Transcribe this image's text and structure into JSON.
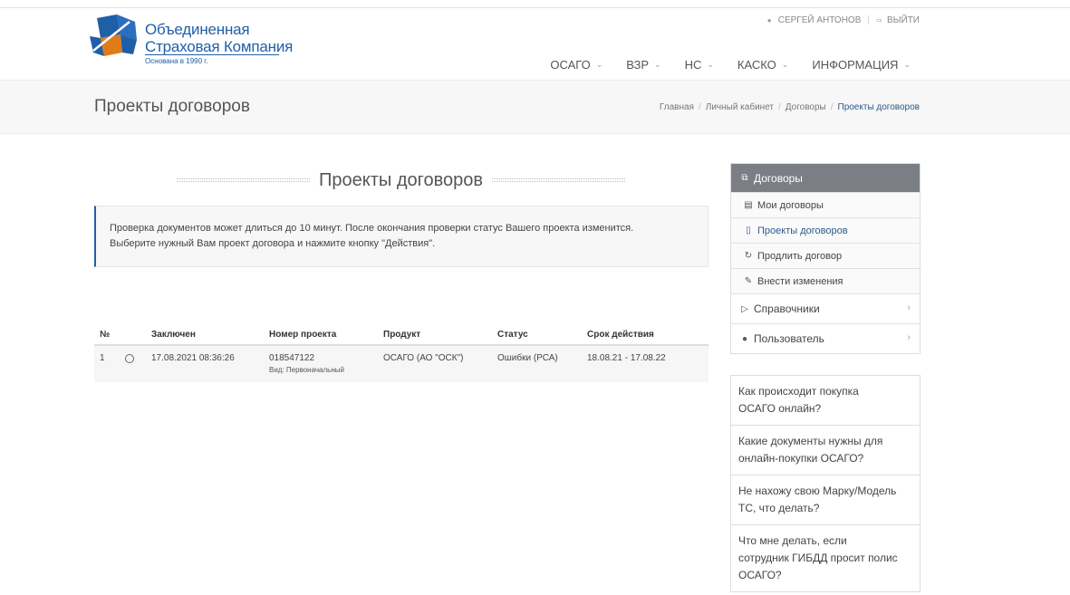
{
  "brand": {
    "line1": "Объединенная",
    "line2": "Страховая Компания",
    "tagline": "Основана в 1990 г.",
    "colors": {
      "blue": "#1f5fa8",
      "orange": "#e07b1a"
    }
  },
  "user_bar": {
    "user_icon": "user-icon",
    "user_name": "СЕРГЕЙ АНТОНОВ",
    "separator": "|",
    "logout_icon": "logout-icon",
    "logout_label": "ВЫЙТИ"
  },
  "nav": {
    "items": [
      {
        "label": "ОСАГО"
      },
      {
        "label": "ВЗР"
      },
      {
        "label": "НС"
      },
      {
        "label": "КАСКО"
      },
      {
        "label": "ИНФОРМАЦИЯ"
      }
    ]
  },
  "page": {
    "title": "Проекты договоров",
    "breadcrumb": [
      "Главная",
      "Личный кабинет",
      "Договоры",
      "Проекты договоров"
    ]
  },
  "content": {
    "heading": "Проекты договоров",
    "notice_line1": "Проверка документов может длиться до 10 минут. После окончания проверки статус Вашего проекта изменится.",
    "notice_line2": "Выберите нужный Вам проект договора и нажмите кнопку \"Действия\"."
  },
  "table": {
    "headers": {
      "no": "№",
      "concluded": "Заключен",
      "project_number": "Номер проекта",
      "product": "Продукт",
      "status": "Статус",
      "term": "Срок действия"
    },
    "rows": [
      {
        "no": "1",
        "concluded": "17.08.2021 08:36:26",
        "project_number": "018547122",
        "kind": "Вид: Первоначальный",
        "product": "ОСАГО (АО \"ОСК\")",
        "status": "Ошибки (РСА)",
        "term": "18.08.21 - 17.08.22"
      }
    ]
  },
  "sidebar": {
    "header": "Договоры",
    "sub_items": [
      {
        "label": "Мои договоры",
        "icon": "document-icon"
      },
      {
        "label": "Проекты договоров",
        "icon": "word-file-icon"
      },
      {
        "label": "Продлить договор",
        "icon": "refresh-icon"
      },
      {
        "label": "Внести изменения",
        "icon": "edit-icon"
      }
    ],
    "main_items": [
      {
        "label": "Справочники",
        "icon": "folder-open-icon"
      },
      {
        "label": "Пользователь",
        "icon": "user-icon"
      }
    ]
  },
  "faq": [
    {
      "line1": "Как происходит покупка",
      "line2": "ОСАГО онлайн?"
    },
    {
      "line1": "Какие документы нужны для",
      "line2": "онлайн-покупки ОСАГО?"
    },
    {
      "line1": "Не нахожу свою Марку/Модель",
      "line2": "ТС, что делать?"
    },
    {
      "line1": "Что мне делать, если",
      "line2": "сотрудник ГИБДД просит полис",
      "line3": "ОСАГО?"
    }
  ]
}
